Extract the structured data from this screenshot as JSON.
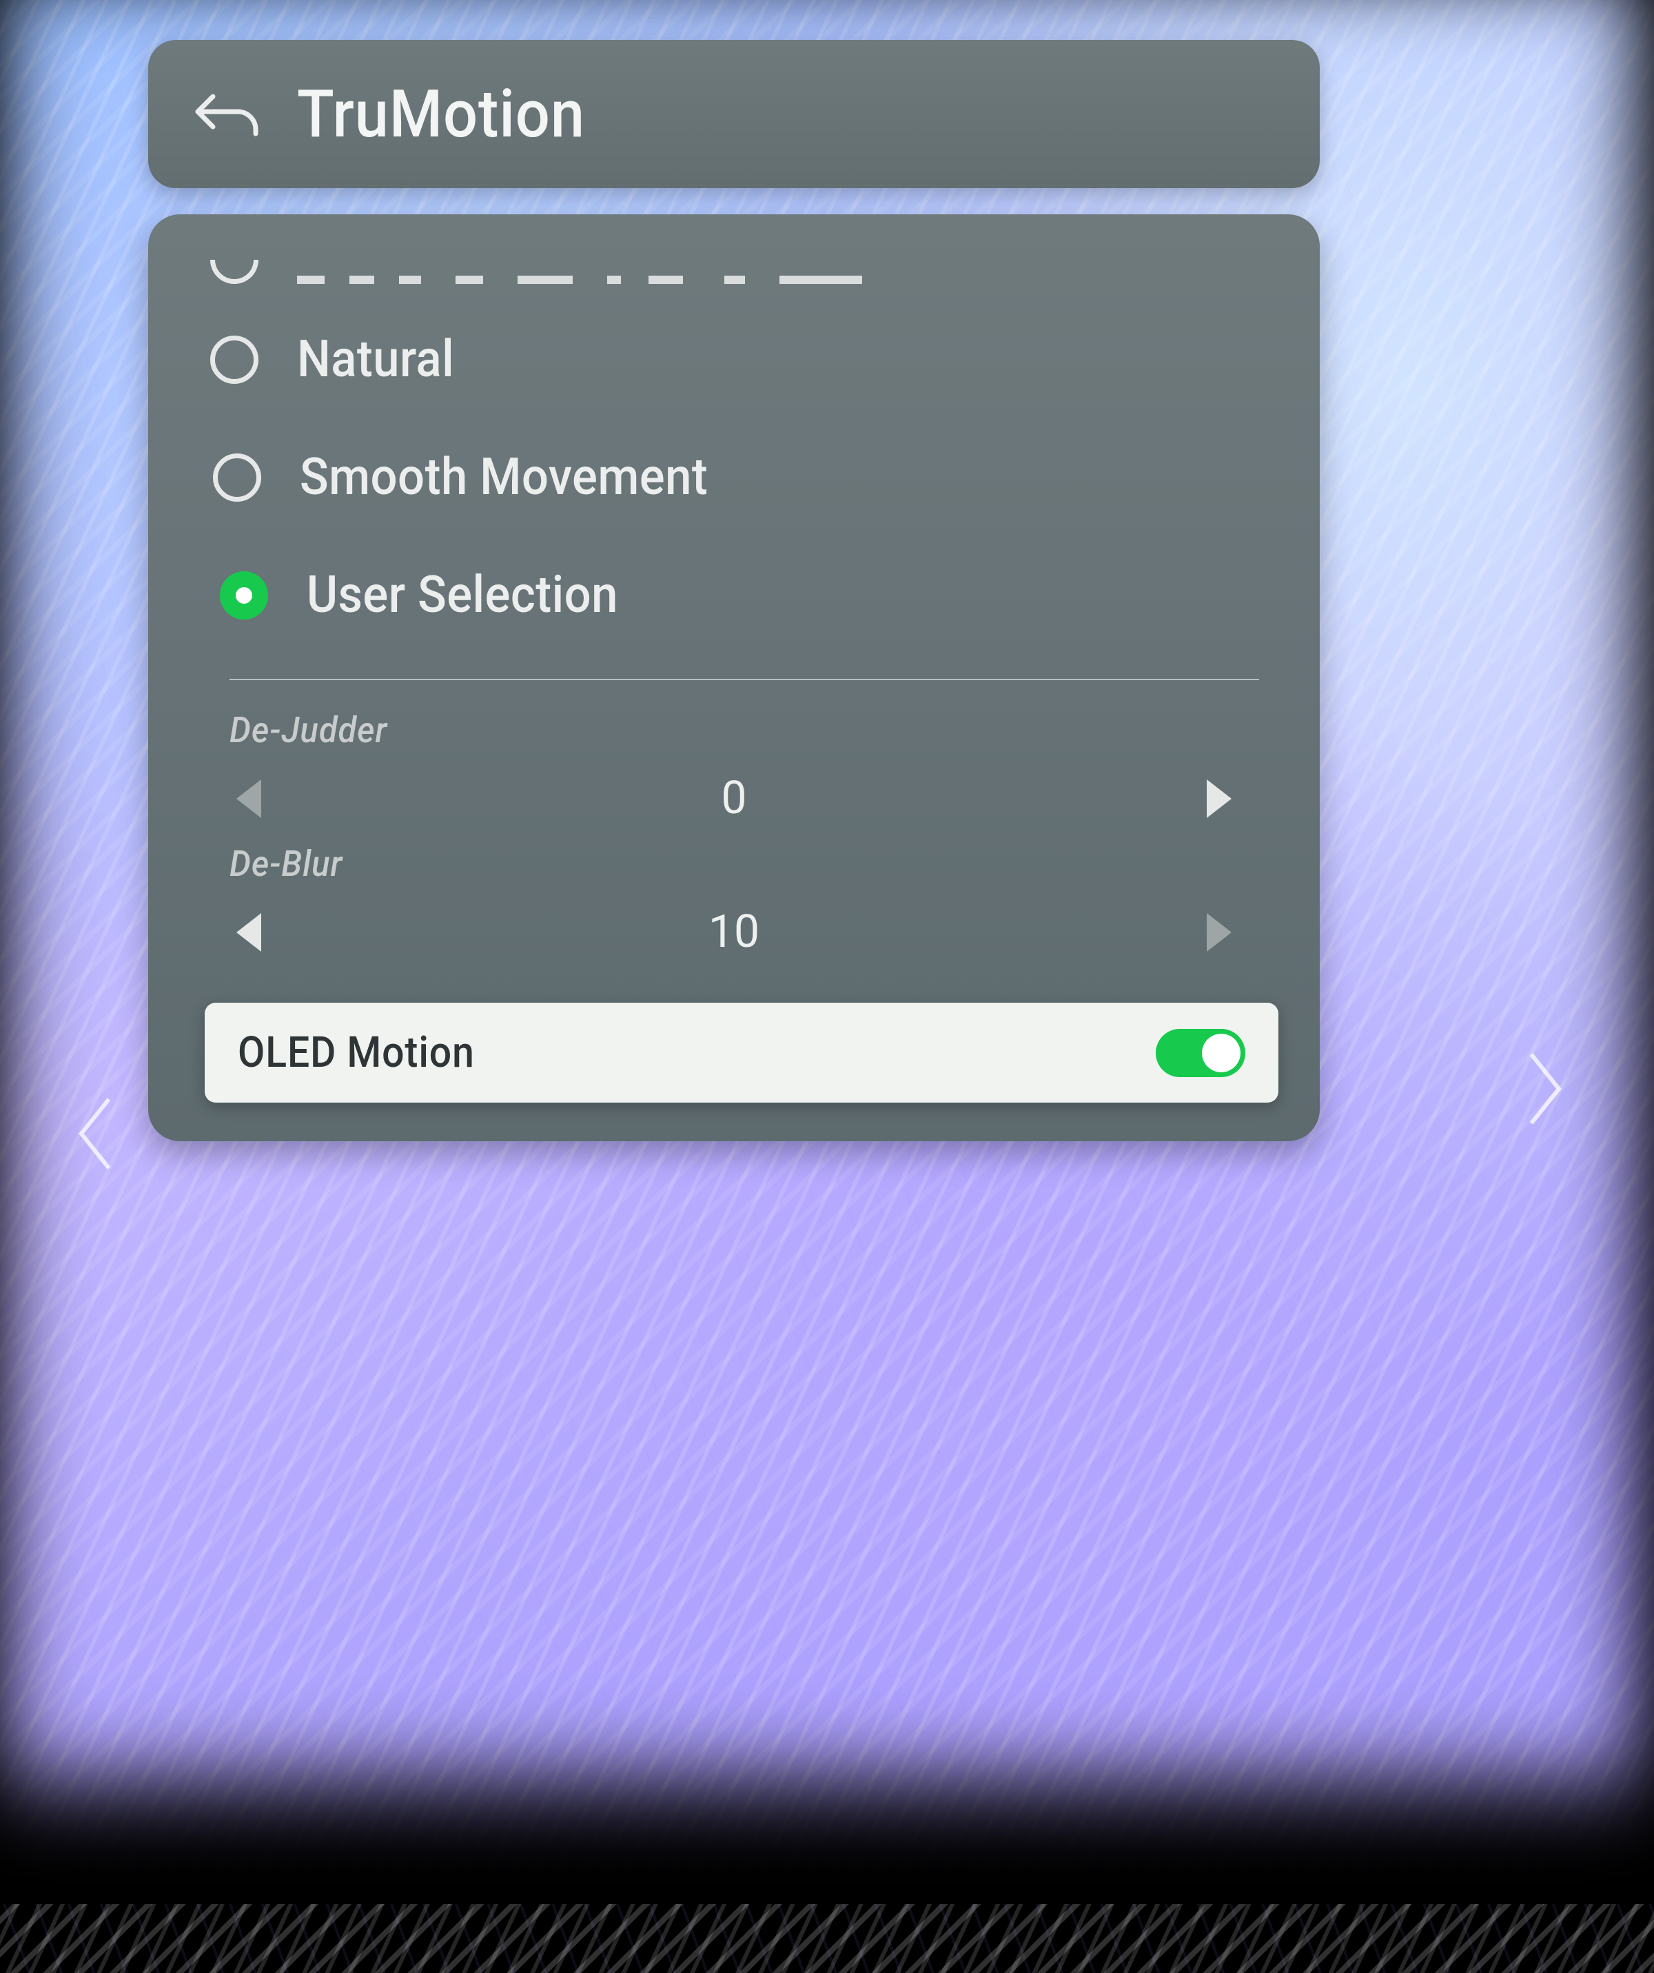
{
  "header": {
    "title": "TruMotion"
  },
  "options": [
    {
      "id": "natural",
      "label": "Natural",
      "selected": false
    },
    {
      "id": "smooth",
      "label": "Smooth Movement",
      "selected": false
    },
    {
      "id": "user",
      "label": "User Selection",
      "selected": true
    }
  ],
  "sliders": {
    "dejudder": {
      "label": "De-Judder",
      "value": "0"
    },
    "deblur": {
      "label": "De-Blur",
      "value": "10"
    }
  },
  "oled": {
    "label": "OLED Motion",
    "on": true
  }
}
